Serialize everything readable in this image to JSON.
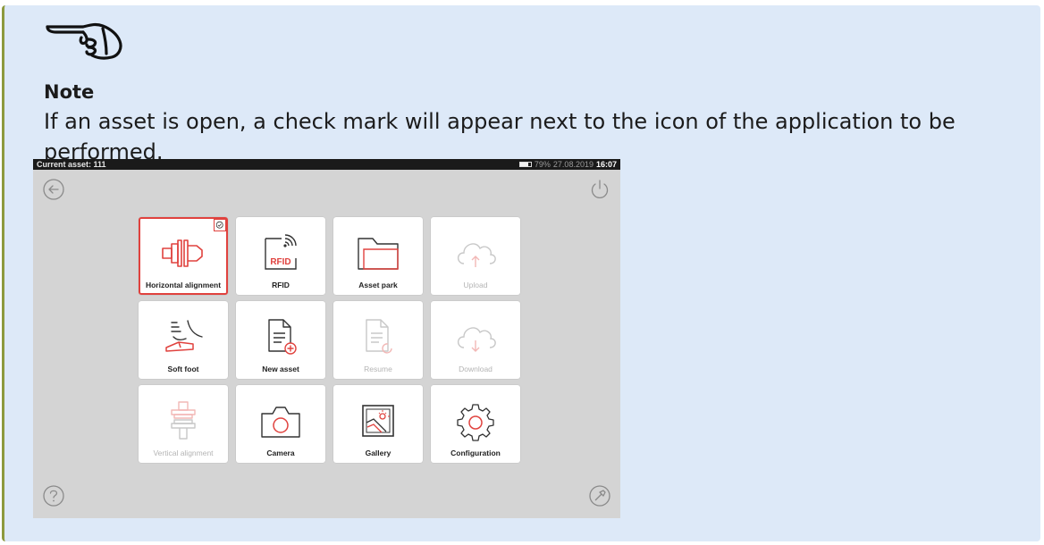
{
  "note": {
    "title": "Note",
    "text": "If an asset is open, a check mark will appear next to the icon of the application to be performed."
  },
  "device": {
    "status_bar": {
      "asset_label": "Current asset: 111",
      "battery_percent": "79%",
      "battery_level": 0.79,
      "date": "27.08.2019",
      "time": "16:07"
    },
    "tiles": [
      {
        "label": "Horizontal alignment",
        "icon": "horizontal-alignment-icon",
        "enabled": true,
        "selected": true
      },
      {
        "label": "RFID",
        "icon": "rfid-icon",
        "enabled": true
      },
      {
        "label": "Asset park",
        "icon": "folder-icon",
        "enabled": true
      },
      {
        "label": "Upload",
        "icon": "cloud-upload-icon",
        "enabled": false
      },
      {
        "label": "Soft foot",
        "icon": "soft-foot-icon",
        "enabled": true
      },
      {
        "label": "New asset",
        "icon": "new-document-icon",
        "enabled": true
      },
      {
        "label": "Resume",
        "icon": "resume-document-icon",
        "enabled": false
      },
      {
        "label": "Download",
        "icon": "cloud-download-icon",
        "enabled": false
      },
      {
        "label": "Vertical alignment",
        "icon": "vertical-alignment-icon",
        "enabled": false
      },
      {
        "label": "Camera",
        "icon": "camera-icon",
        "enabled": true
      },
      {
        "label": "Gallery",
        "icon": "gallery-icon",
        "enabled": true
      },
      {
        "label": "Configuration",
        "icon": "gear-icon",
        "enabled": true
      }
    ]
  },
  "colors": {
    "accent": "#e0423e",
    "note_background": "#dde9f8",
    "note_border": "#8d9a3e",
    "disabled": "#c8c8c8"
  }
}
